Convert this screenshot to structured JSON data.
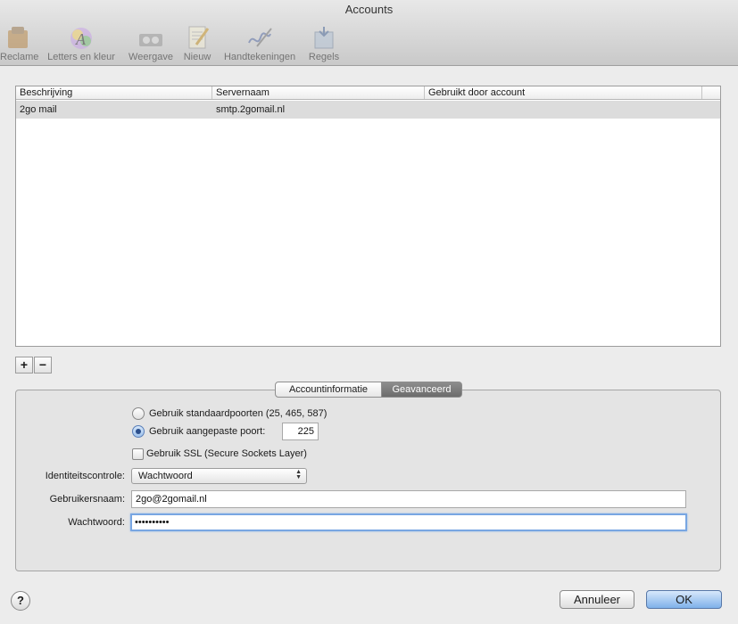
{
  "window": {
    "title": "Accounts"
  },
  "toolbar": {
    "items": [
      {
        "label": "Reclame",
        "icon": "ad-icon"
      },
      {
        "label": "Letters en kleur",
        "icon": "fonts-colors-icon"
      },
      {
        "label": "Weergave",
        "icon": "viewing-icon"
      },
      {
        "label": "Nieuw",
        "icon": "new-icon"
      },
      {
        "label": "Handtekeningen",
        "icon": "signature-icon"
      },
      {
        "label": "Regels",
        "icon": "rules-icon"
      }
    ]
  },
  "table": {
    "columns": [
      "Beschrijving",
      "Servernaam",
      "Gebruikt door account"
    ],
    "rows": [
      {
        "beschrijving": "2go mail",
        "servernaam": "smtp.2gomail.nl",
        "account": ""
      }
    ]
  },
  "buttons": {
    "add": "+",
    "remove": "−",
    "cancel": "Annuleer",
    "ok": "OK",
    "help": "?"
  },
  "tabs": {
    "info": "Accountinformatie",
    "advanced": "Geavanceerd"
  },
  "advanced": {
    "default_ports_label": "Gebruik standaardpoorten (25, 465, 587)",
    "custom_port_label": "Gebruik aangepaste poort:",
    "custom_port_value": "225",
    "ssl_label": "Gebruik SSL (Secure Sockets Layer)",
    "auth_label": "Identiteitscontrole:",
    "auth_value": "Wachtwoord",
    "username_label": "Gebruikersnaam:",
    "username_value": "2go@2gomail.nl",
    "password_label": "Wachtwoord:",
    "password_value": "••••••••••"
  }
}
